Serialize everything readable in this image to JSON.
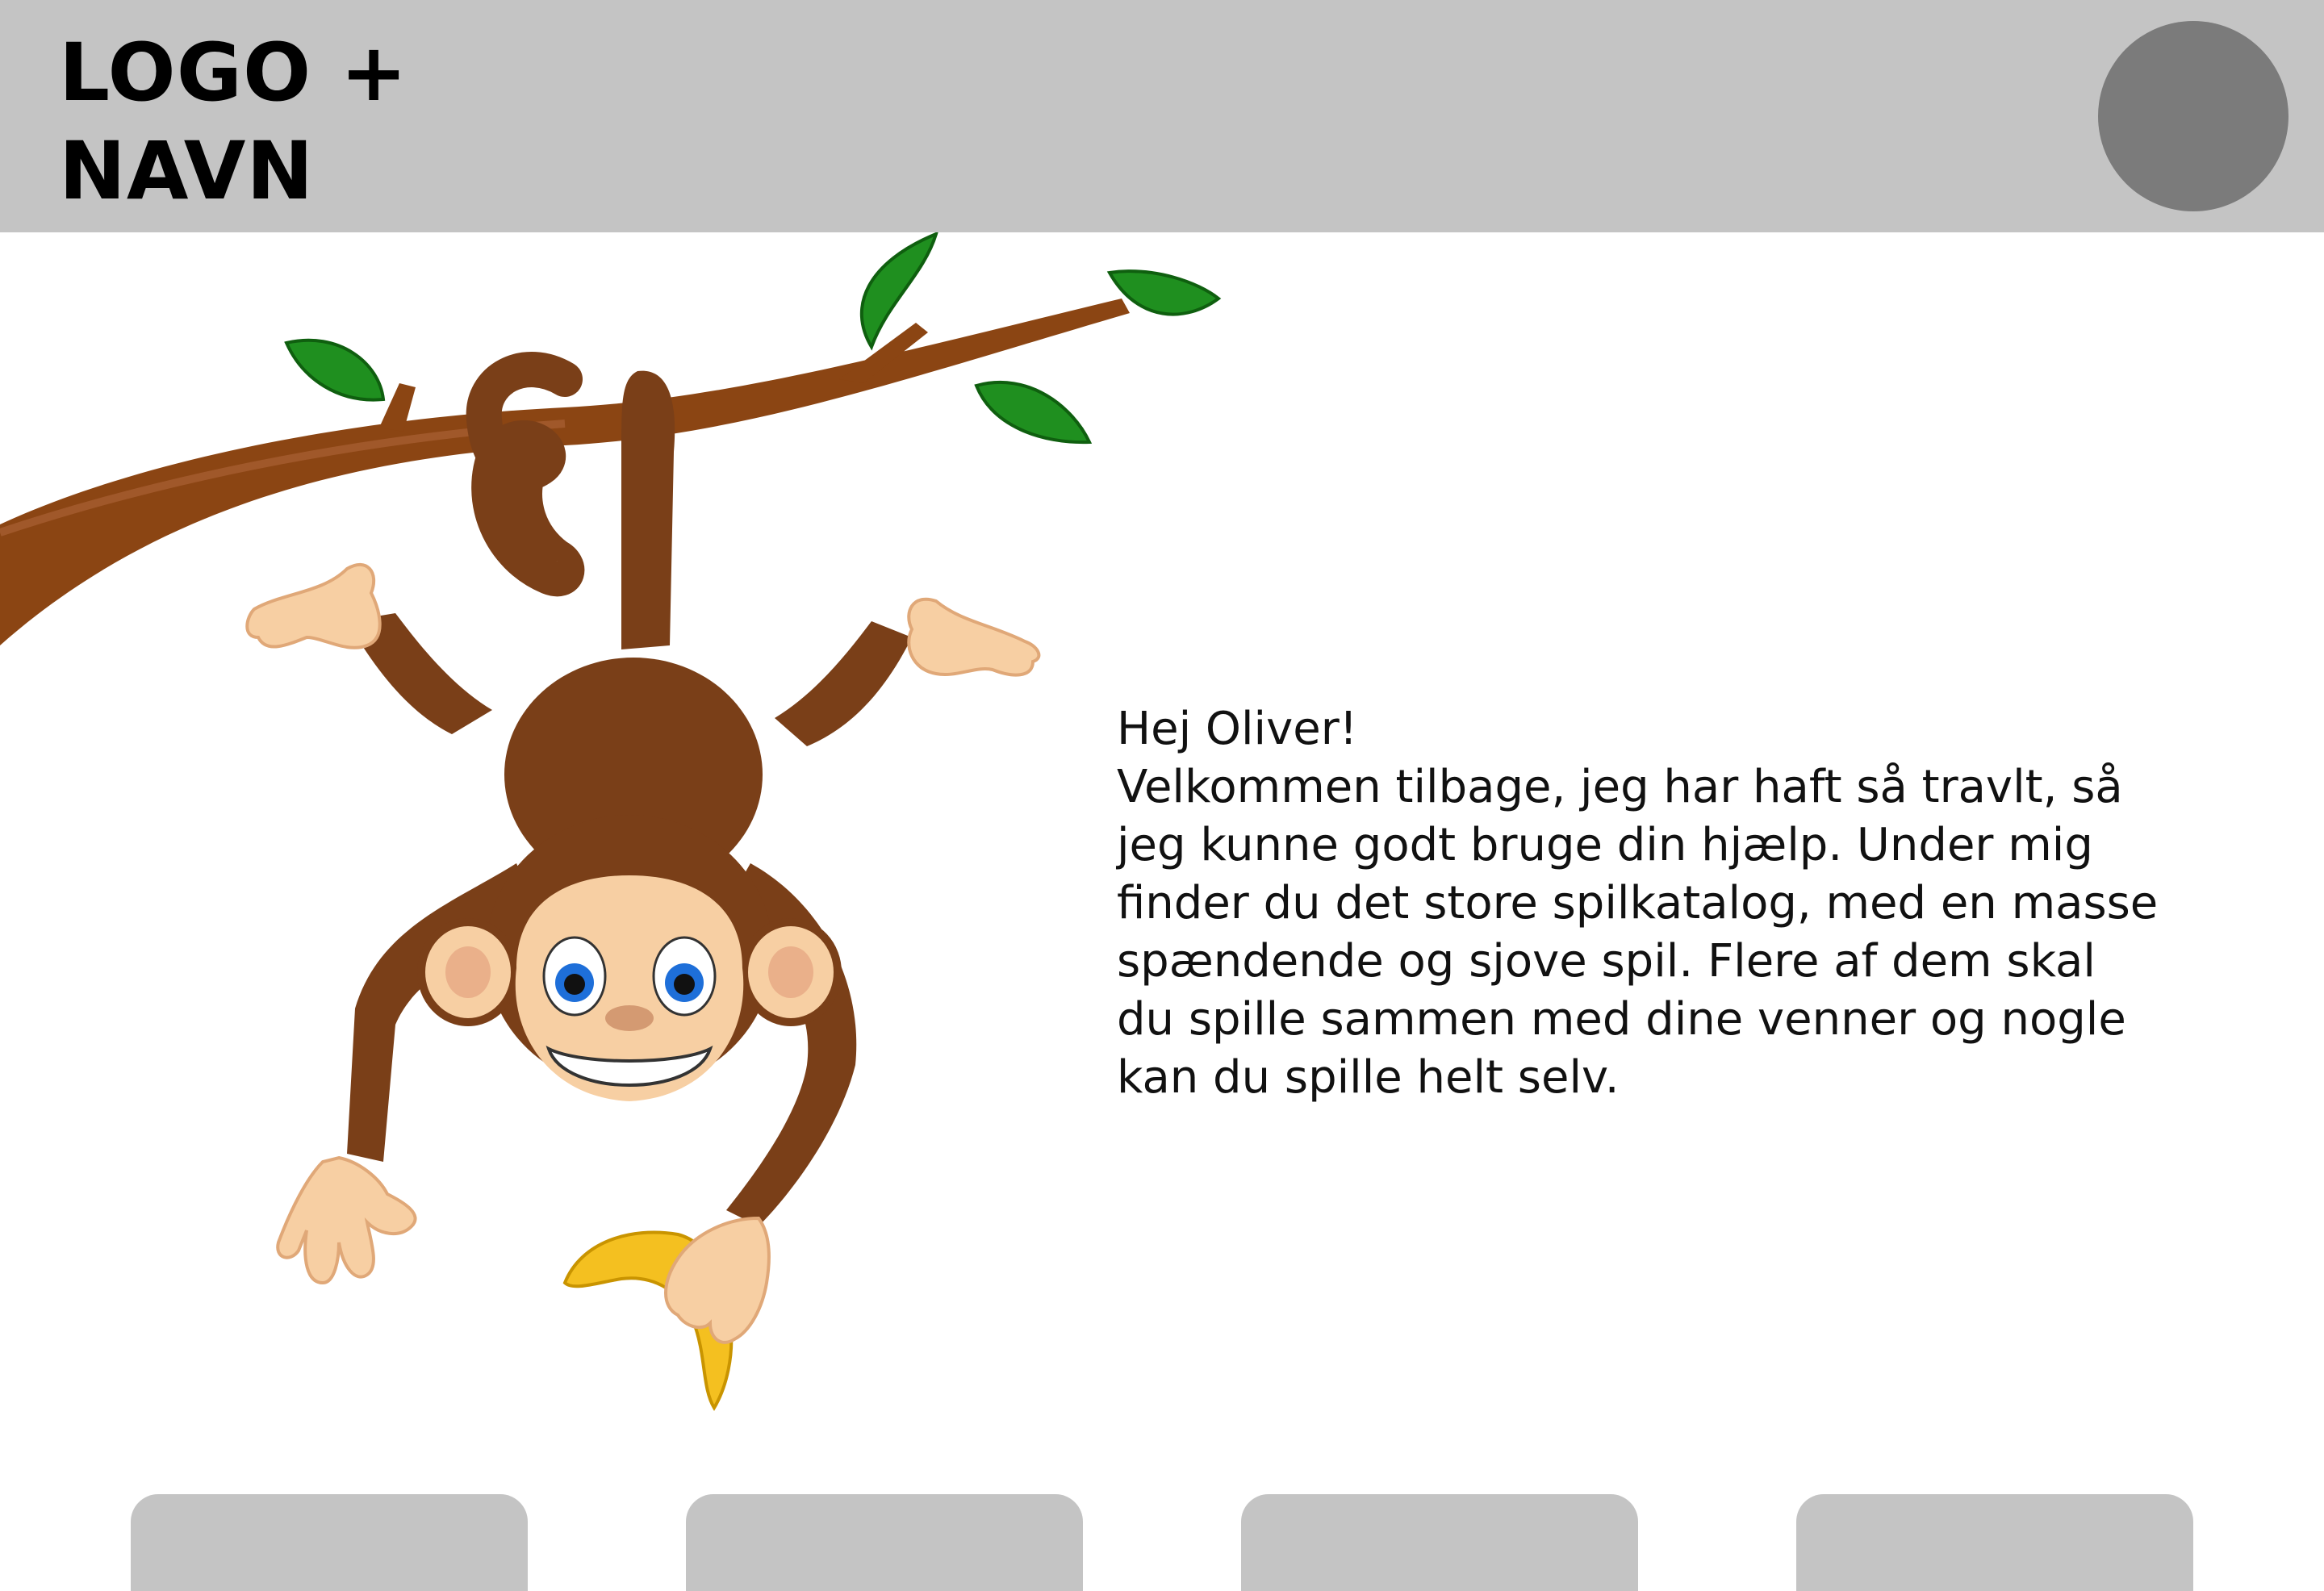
{
  "header": {
    "logo_text": "LOGO +\nNAVN",
    "background": "#c4c4c4",
    "avatar_color": "#7b7b7b"
  },
  "illustration": {
    "subject": "monkey-hanging-from-branch-holding-banana-icon"
  },
  "intro": {
    "greeting": "Hej Oliver!",
    "body": "Velkommen tilbage, jeg har haft så travlt, så jeg kunne godt bruge din hjælp. Under mig finder du det store spilkatalog, med en masse spændende og sjove spil. Flere af dem skal du spille sammen med dine venner og nogle kan du spille helt selv."
  },
  "game_tabs": {
    "count": 4,
    "color": "#c4c4c4"
  }
}
